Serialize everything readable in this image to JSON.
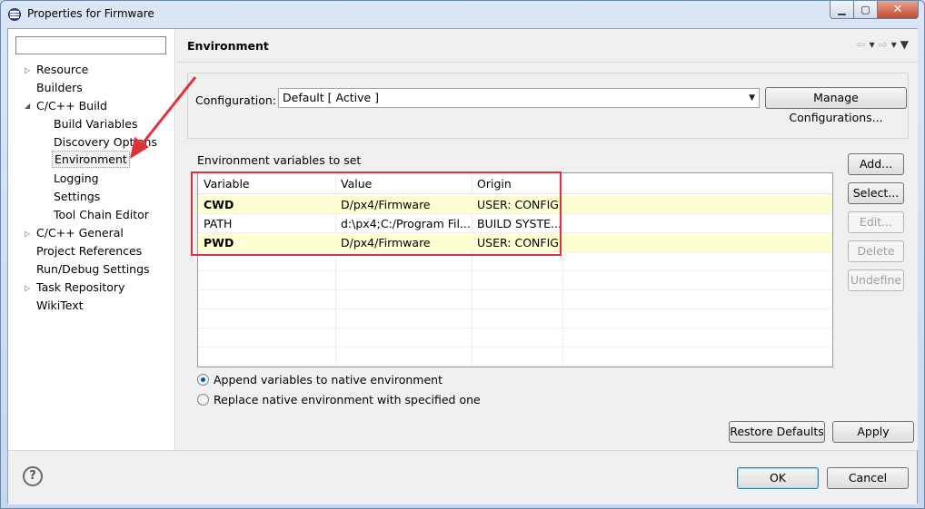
{
  "window": {
    "title": "Properties for Firmware",
    "minimize_glyph": "▁",
    "maximize_glyph": "▢",
    "close_glyph": "✕"
  },
  "sidebar": {
    "filter_placeholder": "",
    "items": [
      {
        "label": "Resource",
        "twisty": "▷"
      },
      {
        "label": "Builders",
        "twisty": ""
      },
      {
        "label": "C/C++ Build",
        "twisty": "◢"
      },
      {
        "label": "Build Variables",
        "twisty": ""
      },
      {
        "label": "Discovery Options",
        "twisty": ""
      },
      {
        "label": "Environment",
        "twisty": ""
      },
      {
        "label": "Logging",
        "twisty": ""
      },
      {
        "label": "Settings",
        "twisty": ""
      },
      {
        "label": "Tool Chain Editor",
        "twisty": ""
      },
      {
        "label": "C/C++ General",
        "twisty": "▷"
      },
      {
        "label": "Project References",
        "twisty": ""
      },
      {
        "label": "Run/Debug Settings",
        "twisty": ""
      },
      {
        "label": "Task Repository",
        "twisty": "▷"
      },
      {
        "label": "WikiText",
        "twisty": ""
      }
    ]
  },
  "page": {
    "title": "Environment",
    "nav": {
      "back": "⇦",
      "back_menu": "▾",
      "forward": "⇨",
      "forward_menu": "▾",
      "view_menu": "▼"
    }
  },
  "configuration": {
    "label": "Configuration:",
    "value": "Default  [ Active ]",
    "dropdown_glyph": "▼",
    "manage_button": "Manage Configurations..."
  },
  "env_table": {
    "section_label": "Environment variables to set",
    "columns": [
      "Variable",
      "Value",
      "Origin"
    ],
    "rows": [
      {
        "variable": "CWD",
        "value": "D/px4/Firmware",
        "origin": "USER: CONFIG"
      },
      {
        "variable": "PATH",
        "value": "d:\\px4;C:/Program Fil...",
        "origin": "BUILD SYSTE..."
      },
      {
        "variable": "PWD",
        "value": "D/px4/Firmware",
        "origin": "USER: CONFIG"
      }
    ]
  },
  "side_buttons": {
    "add": "Add...",
    "select": "Select...",
    "edit": "Edit...",
    "delete": "Delete",
    "undefine": "Undefine"
  },
  "options": {
    "append": "Append variables to native environment",
    "replace": "Replace native environment with specified one",
    "selected": "append"
  },
  "page_buttons": {
    "restore": "Restore Defaults",
    "apply": "Apply"
  },
  "dialog_buttons": {
    "help": "?",
    "ok": "OK",
    "cancel": "Cancel"
  },
  "colors": {
    "annotation_red": "#e0303a",
    "user_row_bg": "#ffffd4"
  }
}
